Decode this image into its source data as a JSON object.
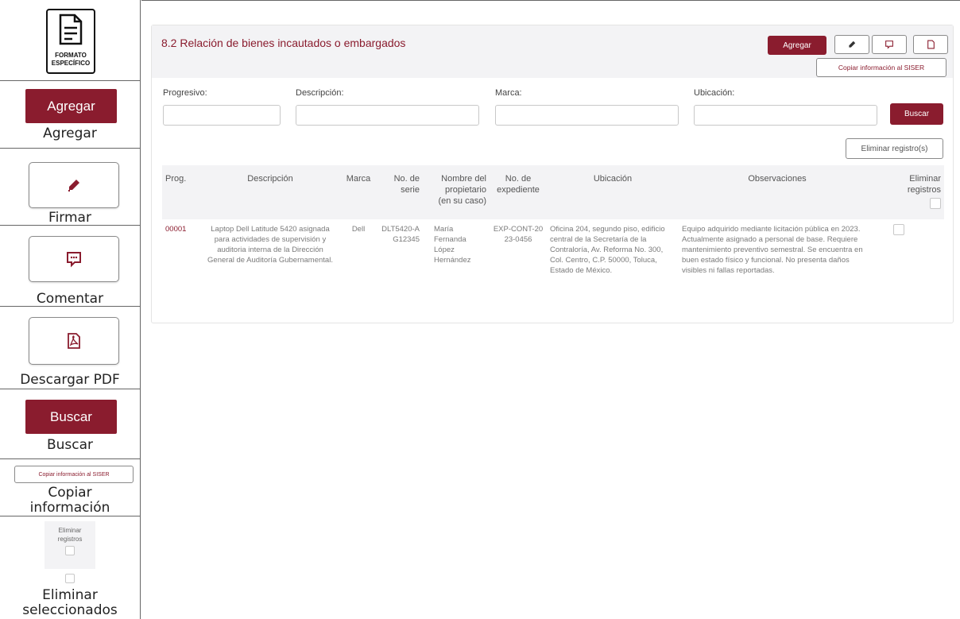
{
  "legend": {
    "formato_especifico": {
      "line1": "FORMATO",
      "line2": "ESPECÍFICO"
    },
    "agregar": {
      "button": "Agregar",
      "caption": "Agregar"
    },
    "firmar": {
      "caption": "Firmar",
      "icon": "pencil-icon"
    },
    "comentar": {
      "caption": "Comentar",
      "icon": "comment-icon"
    },
    "descargar": {
      "caption": "Descargar PDF",
      "icon": "pdf-icon"
    },
    "buscar": {
      "button": "Buscar",
      "caption": "Buscar"
    },
    "copiar": {
      "button": "Copiar información al SISER",
      "caption_line1": "Copiar",
      "caption_line2": "información"
    },
    "eliminar": {
      "header_line1": "Eliminar",
      "header_line2": "registros",
      "caption_line1": "Eliminar",
      "caption_line2": "seleccionados"
    }
  },
  "panel": {
    "title": "8.2 Relación de bienes incautados o embargados",
    "buttons": {
      "agregar": "Agregar",
      "copiar": "Copiar información al SISER"
    }
  },
  "filters": {
    "progresivo": {
      "label": "Progresivo:",
      "value": ""
    },
    "descripcion": {
      "label": "Descripción:",
      "value": ""
    },
    "marca": {
      "label": "Marca:",
      "value": ""
    },
    "ubicacion": {
      "label": "Ubicación:",
      "value": ""
    },
    "buscar": "Buscar"
  },
  "eliminar_registros": "Eliminar registro(s)",
  "table": {
    "headers": {
      "prog": "Prog.",
      "descripcion": "Descripción",
      "marca": "Marca",
      "serie": [
        "No. de",
        "serie"
      ],
      "propietario": [
        "Nombre del",
        "propietario",
        "(en su caso)"
      ],
      "expediente": [
        "No. de",
        "expediente"
      ],
      "ubicacion": "Ubicación",
      "observaciones": "Observaciones",
      "eliminar": [
        "Eliminar",
        "registros"
      ]
    },
    "rows": [
      {
        "prog": "00001",
        "descripcion": "Laptop Dell Latitude 5420 asignada para actividades de supervisión y auditoria interna de la Dirección General de Auditoría Gubernamental.",
        "marca": "Dell",
        "serie": "DLT5420-AG12345",
        "propietario": "María Fernanda López Hernández",
        "expediente": "EXP-CONT-2023-0456",
        "ubicacion": "Oficina 204, segundo piso, edificio central de la Secretaría de la Contraloría, Av. Reforma No. 300, Col. Centro, C.P. 50000, Toluca, Estado de México.",
        "observaciones": "Equipo adquirido mediante licitación pública en 2023. Actualmente asignado a personal de base. Requiere mantenimiento preventivo semestral. Se encuentra en buen estado físico y funcional. No presenta daños visibles ni fallas reportadas."
      }
    ]
  },
  "colors": {
    "accent": "#8a1c2e",
    "header_bg": "#f3f3f5",
    "border": "#c8c8c8"
  }
}
